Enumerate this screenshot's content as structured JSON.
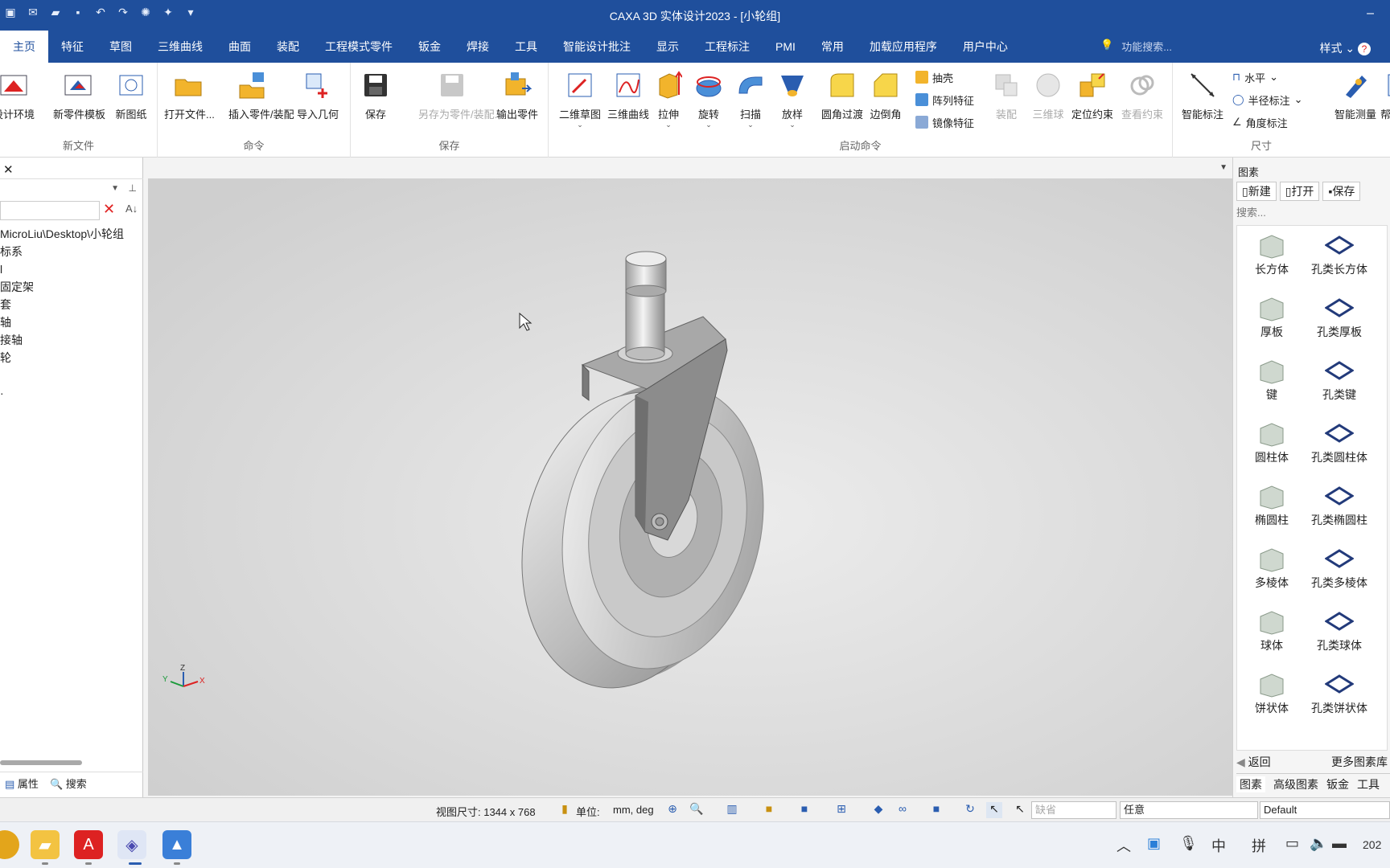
{
  "window": {
    "title": "CAXA 3D 实体设计2023 - [小轮组]"
  },
  "menu": {
    "tabs": [
      "主页",
      "特征",
      "草图",
      "三维曲线",
      "曲面",
      "装配",
      "工程模式零件",
      "钣金",
      "焊接",
      "工具",
      "智能设计批注",
      "显示",
      "工程标注",
      "PMI",
      "常用",
      "加载应用程序",
      "用户中心"
    ],
    "search_placeholder": "功能搜索...",
    "style_label": "样式"
  },
  "ribbon": {
    "groups": {
      "new_file": {
        "label": "新文件",
        "buttons": [
          "设计环境",
          "新零件模板",
          "新图纸"
        ]
      },
      "command": {
        "label": "命令",
        "buttons": [
          "打开文件...",
          "插入零件/装配",
          "导入几何"
        ]
      },
      "save": {
        "label": "保存",
        "buttons": [
          "保存",
          "另存为零件/装配...",
          "输出零件"
        ]
      },
      "start_command": {
        "label": "启动命令",
        "buttons": [
          "二维草图",
          "三维曲线",
          "拉伸",
          "旋转",
          "扫描",
          "放样",
          "圆角过渡",
          "边倒角"
        ],
        "small": [
          "抽壳",
          "阵列特征",
          "镜像特征"
        ],
        "buttons2": [
          "装配",
          "三维球",
          "定位约束",
          "查看约束"
        ]
      },
      "dimension": {
        "label": "尺寸",
        "buttons": [
          "智能标注"
        ],
        "small": [
          "水平",
          "半径标注",
          "角度标注"
        ],
        "measure": "智能测量",
        "help": "帮助"
      }
    }
  },
  "tree": {
    "items": [
      "MicroLiu\\Desktop\\小轮组",
      "标系",
      "l",
      "固定架",
      "套",
      "轴",
      "接轴",
      "轮",
      "",
      "·"
    ]
  },
  "left_tabs": [
    "属性",
    "搜索"
  ],
  "library": {
    "title": "图素",
    "buttons": [
      "新建",
      "打开",
      "保存"
    ],
    "search_placeholder": "搜索...",
    "items": [
      "长方体",
      "孔类长方体",
      "厚板",
      "孔类厚板",
      "键",
      "孔类键",
      "圆柱体",
      "孔类圆柱体",
      "椭圆柱",
      "孔类椭圆柱",
      "多棱体",
      "孔类多棱体",
      "球体",
      "孔类球体",
      "饼状体",
      "孔类饼状体"
    ],
    "back": "返回",
    "more": "更多图素库",
    "tabs": [
      "图素",
      "高级图素",
      "钣金",
      "工具"
    ]
  },
  "status": {
    "view_size": "视图尺寸: 1344 x  768",
    "unit_label": "单位:",
    "unit_value": "mm, deg",
    "select1": "缺省",
    "select2": "任意",
    "select3": "Default"
  },
  "axes": {
    "x": "X",
    "y": "Y",
    "z": "Z"
  },
  "taskbar": {
    "ime1": "中",
    "ime2": "拼",
    "clock_fragment": "202"
  },
  "colors": {
    "brand": "#1f4f9c",
    "viewport": "#d9d9d9"
  }
}
